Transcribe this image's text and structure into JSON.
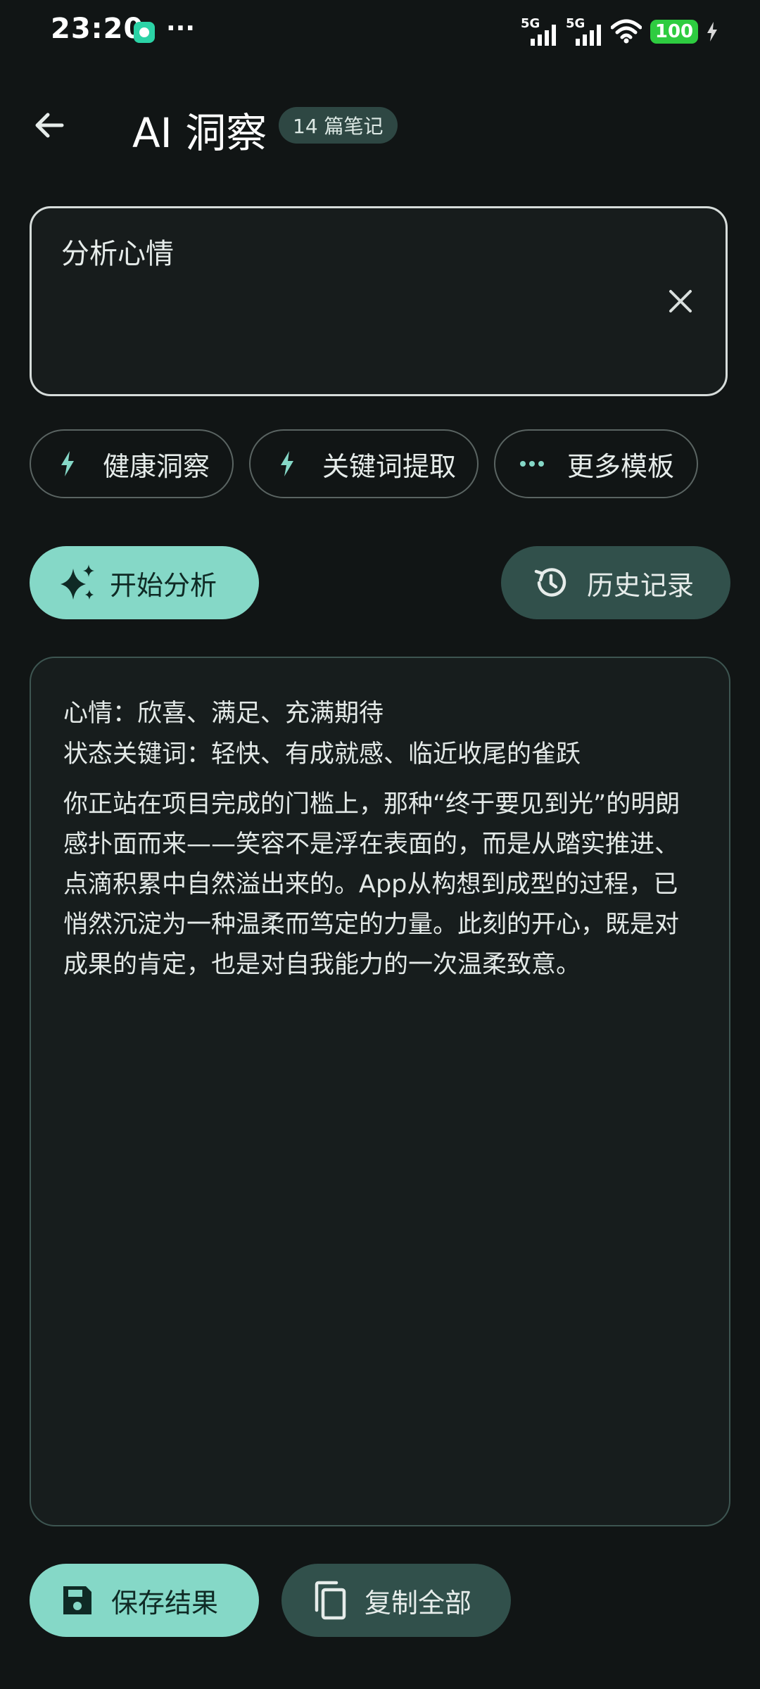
{
  "status_bar": {
    "time": "23:20",
    "dots": "···",
    "network_1": "5G",
    "network_2": "5G",
    "battery": "100",
    "icons": [
      "app-notification-icon",
      "signal-icon",
      "wifi-icon",
      "battery-icon",
      "charging-icon"
    ]
  },
  "app_bar": {
    "title": "AI 洞察",
    "note_count_badge": "14 篇笔记",
    "icons": [
      "back-arrow-icon"
    ]
  },
  "prompt": {
    "value": "分析心情",
    "icons": [
      "close-icon"
    ]
  },
  "templates": [
    {
      "label": "健康洞察",
      "icon": "bolt-icon"
    },
    {
      "label": "关键词提取",
      "icon": "bolt-icon"
    },
    {
      "label": "更多模板",
      "icon": "more-horizontal-icon"
    }
  ],
  "actions": {
    "analyze_label": "开始分析",
    "analyze_icon": "sparkles-icon",
    "history_label": "历史记录",
    "history_icon": "history-icon"
  },
  "result": {
    "mood_line": "心情：欣喜、满足、充满期待",
    "keywords_line": "状态关键词：轻快、有成就感、临近收尾的雀跃",
    "paragraph": "你正站在项目完成的门槛上，那种“终于要见到光”的明朗感扑面而来——笑容不是浮在表面的，而是从踏实推进、点滴积累中自然溢出来的。App从构想到成型的过程，已悄然沉淀为一种温柔而笃定的力量。此刻的开心，既是对成果的肯定，也是对自我能力的一次温柔致意。"
  },
  "bottom_actions": {
    "save_label": "保存结果",
    "save_icon": "save-icon",
    "copy_label": "复制全部",
    "copy_icon": "copy-icon"
  },
  "colors": {
    "background": "#111515",
    "accent": "#85d8c7",
    "tonal_button": "#31504b",
    "badge": "#2e4743",
    "battery": "#2ecc40"
  }
}
